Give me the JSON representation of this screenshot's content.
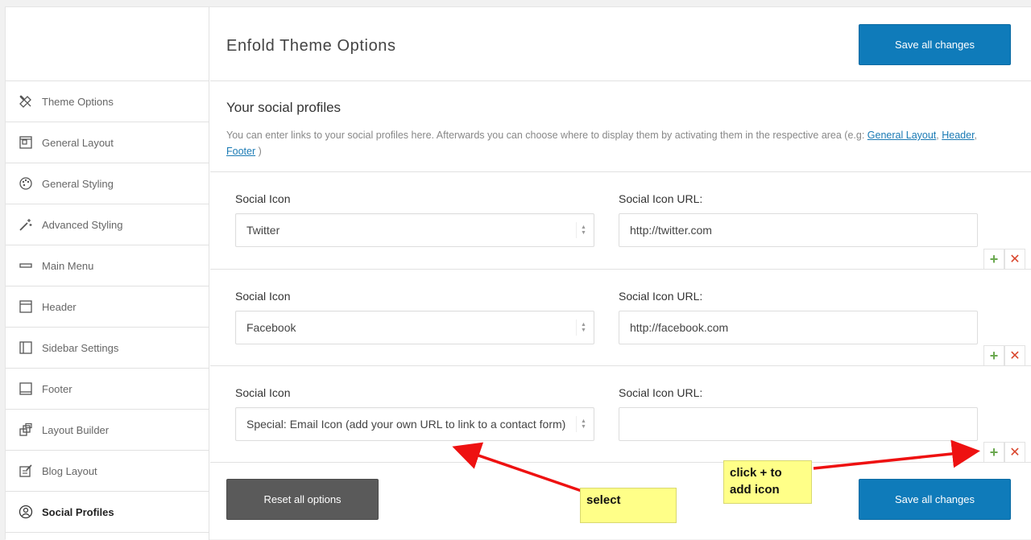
{
  "app": {
    "title": "Enfold Theme Options"
  },
  "buttons": {
    "save_top": "Save all changes",
    "save_bottom": "Save all changes",
    "reset": "Reset all options"
  },
  "sidebar": {
    "items": [
      {
        "label": "Theme Options",
        "icon": "tools-icon",
        "active": false
      },
      {
        "label": "General Layout",
        "icon": "layout-icon",
        "active": false
      },
      {
        "label": "General Styling",
        "icon": "palette-icon",
        "active": false
      },
      {
        "label": "Advanced Styling",
        "icon": "magic-wand-icon",
        "active": false
      },
      {
        "label": "Main Menu",
        "icon": "menu-icon",
        "active": false
      },
      {
        "label": "Header",
        "icon": "header-icon",
        "active": false
      },
      {
        "label": "Sidebar Settings",
        "icon": "sidebar-icon",
        "active": false
      },
      {
        "label": "Footer",
        "icon": "footer-icon",
        "active": false
      },
      {
        "label": "Layout Builder",
        "icon": "layout-builder-icon",
        "active": false
      },
      {
        "label": "Blog Layout",
        "icon": "blog-icon",
        "active": false
      },
      {
        "label": "Social Profiles",
        "icon": "social-profile-icon",
        "active": true
      }
    ]
  },
  "section": {
    "title": "Your social profiles",
    "desc_prefix": "You can enter links to your social profiles here. Afterwards you can choose where to display them by activating them in the respective area (e.g: ",
    "link_general_layout": "General Layout",
    "sep1": ", ",
    "link_header": "Header",
    "sep2": ",",
    "link_footer": "Footer",
    "desc_suffix": " )"
  },
  "labels": {
    "social_icon": "Social Icon",
    "social_icon_url": "Social Icon URL:"
  },
  "rows": [
    {
      "icon": "Twitter",
      "url": "http://twitter.com"
    },
    {
      "icon": "Facebook",
      "url": "http://facebook.com"
    },
    {
      "icon": "Special: Email Icon (add your own URL to link to a contact form)",
      "url": ""
    }
  ],
  "controls": {
    "add": "+",
    "remove": "✕",
    "select_arrows_up": "▲",
    "select_arrows_down": "▼"
  },
  "annotations": {
    "select_note": "select",
    "click_note_line1": "click + to",
    "click_note_line2": "add icon"
  },
  "colors": {
    "primary": "#0f7bba",
    "reset": "#5a5a5a",
    "add": "#6aa84f",
    "remove": "#d9442b",
    "arrow": "#ee1111",
    "note": "#ffff88"
  }
}
